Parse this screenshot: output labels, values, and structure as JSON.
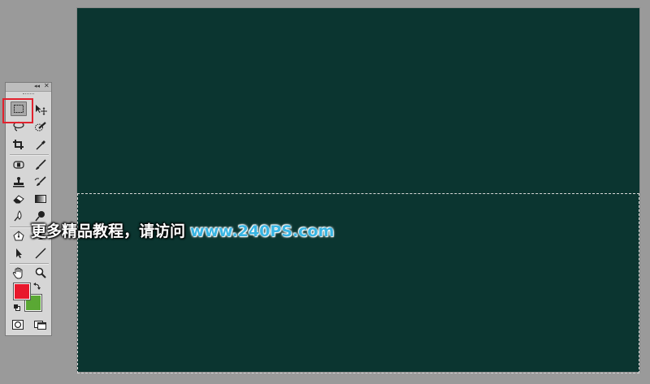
{
  "colors": {
    "canvas": "#0b3530",
    "workspace": "#9a9a9a",
    "foreground": "#e8182c",
    "background": "#5aa834",
    "highlight": "#e2222e",
    "url": "#39b5e3"
  },
  "toolbox": {
    "collapse_glyph": "◂◂",
    "close_glyph": "✕",
    "tools": [
      {
        "name": "rectangular-marquee",
        "icon": "marquee-icon",
        "active": true
      },
      {
        "name": "move",
        "icon": "move-icon"
      },
      {
        "name": "lasso",
        "icon": "lasso-icon"
      },
      {
        "name": "quick-selection",
        "icon": "quick-selection-icon"
      },
      {
        "name": "crop",
        "icon": "crop-icon"
      },
      {
        "name": "eyedropper",
        "icon": "eyedropper-icon"
      },
      {
        "name": "spot-healing",
        "icon": "bandage-icon"
      },
      {
        "name": "brush",
        "icon": "brush-icon"
      },
      {
        "name": "clone-stamp",
        "icon": "stamp-icon"
      },
      {
        "name": "history-brush",
        "icon": "history-brush-icon"
      },
      {
        "name": "eraser",
        "icon": "eraser-icon"
      },
      {
        "name": "gradient",
        "icon": "gradient-icon"
      },
      {
        "name": "blur",
        "icon": "blur-icon"
      },
      {
        "name": "dodge",
        "icon": "dodge-icon"
      },
      {
        "name": "pen",
        "icon": "pen-icon"
      },
      {
        "name": "type",
        "icon": "type-icon"
      },
      {
        "name": "path-selection",
        "icon": "arrow-icon"
      },
      {
        "name": "line",
        "icon": "line-icon"
      },
      {
        "name": "hand",
        "icon": "hand-icon"
      },
      {
        "name": "zoom",
        "icon": "zoom-icon"
      },
      {
        "name": "quick-mask",
        "icon": "quick-mask-icon"
      },
      {
        "name": "screen-mode",
        "icon": "screen-mode-icon"
      }
    ],
    "type_glyph": "T"
  },
  "watermark": {
    "text_cn": "更多精品教程，请访问",
    "url": "www.240PS.com"
  }
}
